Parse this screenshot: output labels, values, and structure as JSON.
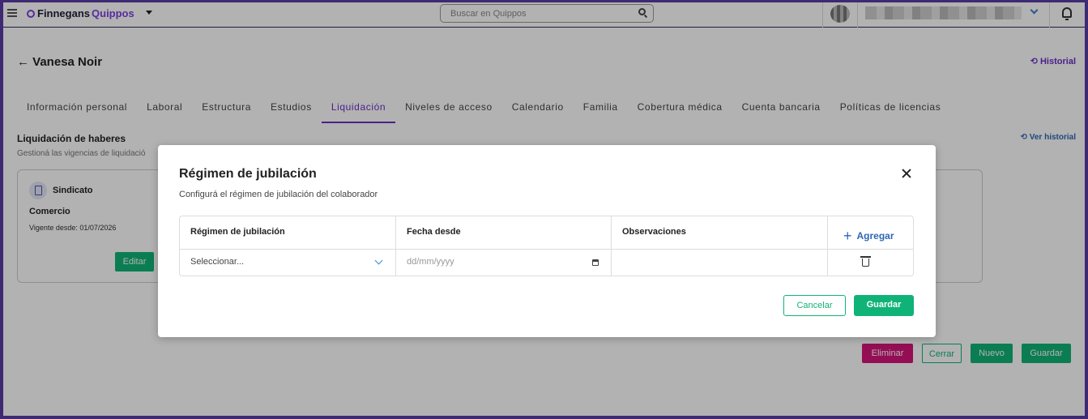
{
  "app": {
    "brand_part1": "Finnegans",
    "brand_part2": "Quippos"
  },
  "search": {
    "placeholder": "Buscar en Quippos"
  },
  "header": {
    "back_label": "← Vanesa Noir",
    "historial_label": "Historial"
  },
  "tabs": [
    {
      "label": "Información personal",
      "active": false
    },
    {
      "label": "Laboral",
      "active": false
    },
    {
      "label": "Estructura",
      "active": false
    },
    {
      "label": "Estudios",
      "active": false
    },
    {
      "label": "Liquidación",
      "active": true
    },
    {
      "label": "Niveles de acceso",
      "active": false
    },
    {
      "label": "Calendario",
      "active": false
    },
    {
      "label": "Familia",
      "active": false
    },
    {
      "label": "Cobertura médica",
      "active": false
    },
    {
      "label": "Cuenta bancaria",
      "active": false
    },
    {
      "label": "Políticas de licencias",
      "active": false
    }
  ],
  "section": {
    "title": "Liquidación de haberes",
    "subtitle": "Gestioná las vigencias de liquidació",
    "ver_historial": "Ver historial"
  },
  "card": {
    "title": "Sindicato",
    "value": "Comercio",
    "vigente": "Vigente desde: 01/07/2026",
    "edit_label": "Editar"
  },
  "footer_buttons": {
    "eliminar": "Eliminar",
    "cerrar": "Cerrar",
    "nuevo": "Nuevo",
    "guardar": "Guardar"
  },
  "modal": {
    "title": "Régimen de jubilación",
    "subtitle": "Configurá el régimen de jubilación del colaborador",
    "columns": [
      "Régimen de jubilación",
      "Fecha desde",
      "Observaciones"
    ],
    "add_label": "Agregar",
    "row": {
      "regimen": "Seleccionar...",
      "fecha_placeholder": "dd/mm/yyyy",
      "observaciones": ""
    },
    "cancel_label": "Cancelar",
    "save_label": "Guardar"
  }
}
